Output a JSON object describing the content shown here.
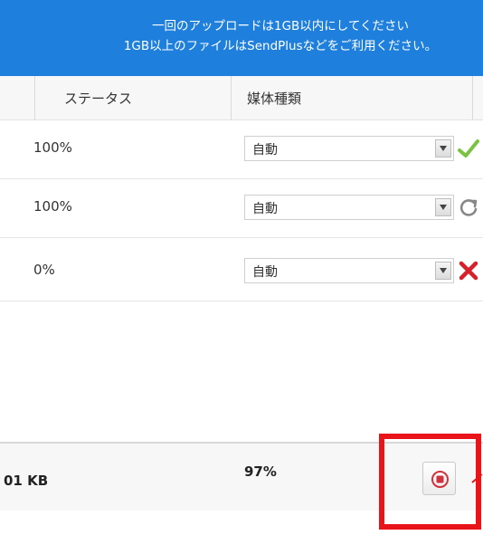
{
  "notice": {
    "line1": "一回のアップロードは1GB以内にしてください",
    "line2": "1GB以上のファイルはSendPlusなどをご利用ください。"
  },
  "table": {
    "columns": {
      "status": "ステータス",
      "media": "媒体種類"
    },
    "rows": [
      {
        "progress": "100%",
        "media": "自動",
        "state_icon": "check-icon"
      },
      {
        "progress": "100%",
        "media": "自動",
        "state_icon": "refresh-icon"
      },
      {
        "progress": "0%",
        "media": "自動",
        "state_icon": "x-icon"
      }
    ]
  },
  "footer": {
    "total_size": "01 KB",
    "total_progress": "97%",
    "stop_icon": "stop-icon"
  },
  "colors": {
    "banner": "#1f7fdc",
    "success": "#7cc242",
    "error": "#d6202a",
    "annotation": "#e8141a"
  }
}
